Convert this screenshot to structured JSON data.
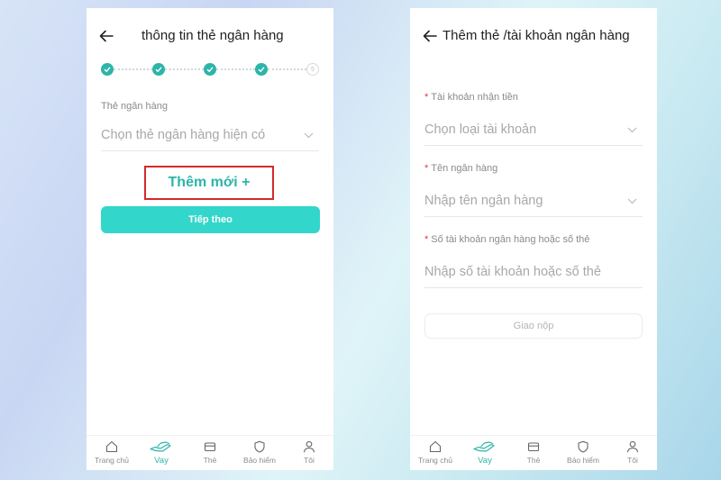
{
  "left_screen": {
    "header_title": "thông tin thẻ ngân hàng",
    "stepper": {
      "current_step": 5,
      "total_steps": 5,
      "pending_label": "5"
    },
    "card_field": {
      "label": "Thẻ ngân hàng",
      "placeholder": "Chọn thẻ ngân hàng hiện có"
    },
    "add_new_label": "Thêm mới +",
    "next_button_label": "Tiếp theo"
  },
  "right_screen": {
    "header_title": "Thêm thẻ /tài khoản ngân hàng",
    "required_marker": "*",
    "account_type_field": {
      "label": "Tài khoản nhận tiền",
      "placeholder": "Chọn loại tài khoản"
    },
    "bank_name_field": {
      "label": "Tên ngân hàng",
      "placeholder": "Nhập tên ngân hàng"
    },
    "account_number_field": {
      "label": "Số tài khoản ngân hàng hoặc số thẻ",
      "placeholder": "Nhập số tài khoản hoặc số thẻ"
    },
    "submit_button_label": "Giao nộp"
  },
  "bottom_nav": {
    "items": [
      {
        "label": "Trang chủ",
        "icon": "home-icon"
      },
      {
        "label": "Vay",
        "icon": "loan-hand-icon",
        "active": true
      },
      {
        "label": "Thẻ",
        "icon": "card-icon"
      },
      {
        "label": "Bảo hiểm",
        "icon": "shield-icon"
      },
      {
        "label": "Tôi",
        "icon": "user-icon"
      }
    ]
  },
  "colors": {
    "accent": "#2cb5a8",
    "button": "#33d6cb",
    "highlight_border": "#d22b2b",
    "required": "#e53935"
  }
}
